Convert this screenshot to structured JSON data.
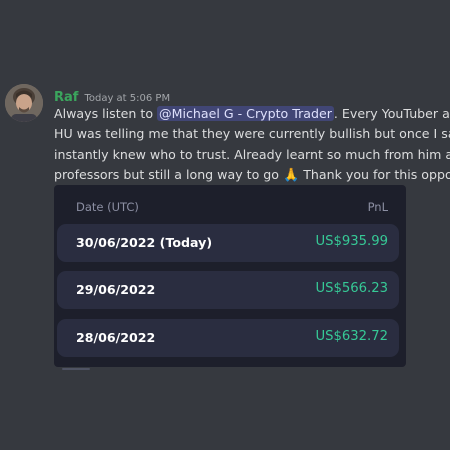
{
  "message": {
    "author": "Raf",
    "timestamp": "Today at 5:06 PM",
    "lines": [
      {
        "before": "Always listen to ",
        "mention": "@Michael G - Crypto Trader",
        "after": ". Every YouTuber and ir"
      },
      {
        "text": "HU was telling me that they were currently bullish but once I saw Mi"
      },
      {
        "text": "instantly knew who to trust. Already learnt so much from him and th"
      },
      {
        "before": "professors but still a long way to go ",
        "emoji": "🙏",
        "after": " Thank you for this opportuni"
      }
    ]
  },
  "pnl_card": {
    "col_date": "Date (UTC)",
    "col_pnl": "PnL",
    "rows": [
      {
        "date": "30/06/2022 (Today)",
        "value": "US$935.99"
      },
      {
        "date": "29/06/2022",
        "value": "US$566.23"
      },
      {
        "date": "28/06/2022",
        "value": "US$632.72"
      }
    ],
    "value_color": "#36c996"
  },
  "colors": {
    "background": "#36393f",
    "author": "#3ba55d",
    "mention_bg": "#414675",
    "card_bg": "#1d1f2b",
    "row_bg": "#2a2d40"
  }
}
